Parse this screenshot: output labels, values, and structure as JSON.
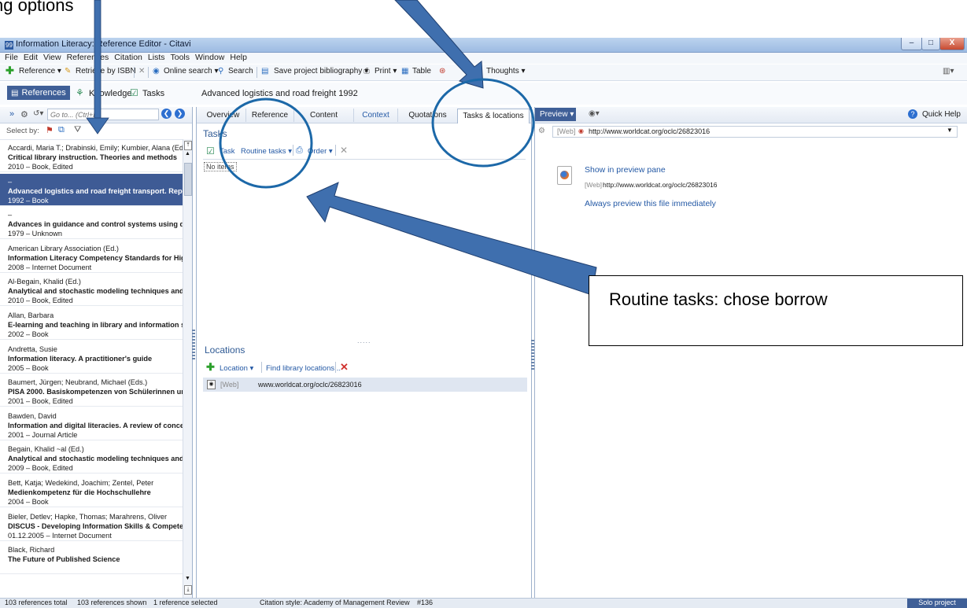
{
  "window": {
    "title": "Information Literacy: Reference Editor - Citavi",
    "minimize": "–",
    "maximize": "□",
    "close": "X"
  },
  "menu": [
    "File",
    "Edit",
    "View",
    "References",
    "Citation",
    "Lists",
    "Tools",
    "Window",
    "Help"
  ],
  "toolbar": {
    "reference": "Reference ▾",
    "retrieve_isbn": "Retrieve by ISBN",
    "online_search": "Online search ▾",
    "search": "Search",
    "save_bibliography": "Save project bibliography ▾",
    "print": "Print ▾",
    "table": "Table",
    "thoughts": "Thoughts ▾"
  },
  "nav": {
    "references": "References",
    "knowledge": "Knowledge",
    "tasks": "Tasks",
    "reference_title": "Advanced logistics and road freight 1992"
  },
  "left": {
    "goto_placeholder": "Go to... (Ctrl+E)",
    "select_by": "Select by:",
    "references": [
      {
        "authors": "Accardi, Maria T.; Drabinski, Emily; Kumbier, Alana (Eds.",
        "title": "Critical library instruction. Theories and methods",
        "meta": "2010 – Book, Edited",
        "selected": false
      },
      {
        "authors": "–",
        "title": "Advanced logistics and road freight transport. Report",
        "meta": "1992 – Book",
        "selected": true
      },
      {
        "authors": "–",
        "title": "Advances in guidance and control systems using digita",
        "meta": "1979 – Unknown",
        "selected": false
      },
      {
        "authors": "American Library Association (Ed.)",
        "title": "Information Literacy Competency Standards for Highe",
        "meta": "2008 – Internet Document",
        "selected": false
      },
      {
        "authors": "Al-Begain, Khalid (Ed.)",
        "title": "Analytical and stochastic modeling techniques and app",
        "meta": "2010 – Book, Edited",
        "selected": false
      },
      {
        "authors": "Allan, Barbara",
        "title": "E-learning and teaching in library and information serv",
        "meta": "2002 – Book",
        "selected": false
      },
      {
        "authors": "Andretta, Susie",
        "title": "Information literacy. A practitioner's guide",
        "meta": "2005 – Book",
        "selected": false
      },
      {
        "authors": "Baumert, Jürgen; Neubrand, Michael (Eds.)",
        "title": "PISA 2000. Basiskompetenzen von Schülerinnen und",
        "meta": "2001 – Book, Edited",
        "selected": false
      },
      {
        "authors": "Bawden, David",
        "title": "Information and digital literacies. A review of concept",
        "meta": "2001 – Journal Article",
        "selected": false
      },
      {
        "authors": "Begain, Khalid ~al (Ed.)",
        "title": "Analytical and stochastic modeling techniques and app",
        "meta": "2009 – Book, Edited",
        "selected": false
      },
      {
        "authors": "Bett, Katja; Wedekind, Joachim; Zentel, Peter",
        "title": "Medienkompetenz für die Hochschullehre",
        "meta": "2004 – Book",
        "selected": false
      },
      {
        "authors": "Bieler, Detlev; Hapke, Thomas; Marahrens, Oliver",
        "title": "DISCUS - Developing Information Skills & Competenc",
        "meta": "01.12.2005 – Internet Document",
        "selected": false
      },
      {
        "authors": "Black, Richard",
        "title": "The Future of Published Science",
        "meta": "",
        "selected": false
      }
    ]
  },
  "middle": {
    "tabs": [
      "Overview",
      "Reference",
      "Content",
      "Context",
      "Quotations",
      "Tasks & locations"
    ],
    "tasks_title": "Tasks",
    "task_btn": "Task",
    "routine_tasks": "Routine tasks ▾",
    "order": "Order ▾",
    "no_items": "No items",
    "locations_title": "Locations",
    "location_btn": "Location ▾",
    "find_library": "Find library locations...",
    "location_row": {
      "type": "[Web]",
      "value": "www.worldcat.org/oclc/26823016"
    },
    "splitter": "....."
  },
  "right": {
    "preview_btn": "Preview ▾",
    "quick_help": "Quick Help",
    "url_prefix": "[Web]",
    "url": "http://www.worldcat.org/oclc/26823016",
    "show_preview": "Show in preview pane",
    "web_prefix": "[Web]",
    "web_url": "http://www.worldcat.org/oclc/26823016",
    "always_preview": "Always preview this file immediately"
  },
  "status": {
    "total": "103 references total",
    "shown": "103 references shown",
    "selected": "1 reference selected",
    "citation_style": "Citation style: Academy of Management Review",
    "number": "#136",
    "solo": "Solo project"
  },
  "annotation": {
    "callout": "Routine tasks: chose borrow",
    "top_fragment": "ng options"
  },
  "colors": {
    "arrow": "#3f6fae",
    "ring": "#1c68a8",
    "selection": "#3e5b95"
  }
}
